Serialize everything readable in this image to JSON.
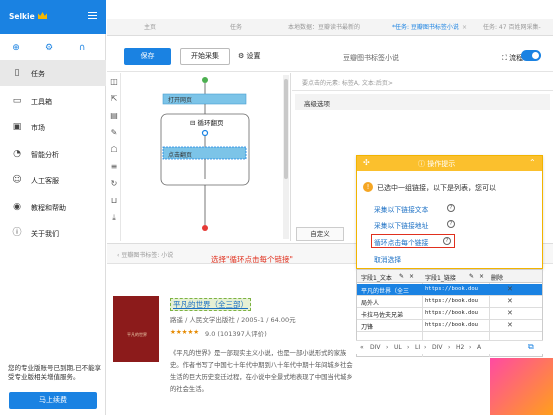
{
  "sidebar": {
    "logo": "Selkie",
    "items": [
      {
        "label": "任务",
        "icon": "file-icon",
        "active": true
      },
      {
        "label": "工具箱",
        "icon": "toolbox-icon",
        "active": false
      },
      {
        "label": "市场",
        "icon": "market-icon",
        "active": false
      },
      {
        "label": "智能分析",
        "icon": "analytics-icon",
        "active": false
      },
      {
        "label": "人工客服",
        "icon": "customer-service-icon",
        "active": false
      },
      {
        "label": "教程和帮助",
        "icon": "help-icon",
        "active": false
      },
      {
        "label": "关于我们",
        "icon": "info-icon",
        "active": false
      }
    ],
    "note": "您的专业版账号已到期,已不能享受专业版相关增值服务。",
    "renew_button": "马上续费"
  },
  "tabs": [
    {
      "label": "主页",
      "active": false
    },
    {
      "label": "任务",
      "active": false
    },
    {
      "label": "本地数据：豆瓣读书最新的",
      "active": false
    },
    {
      "label": "*任务: 豆瓣图书标签小说",
      "active": true
    },
    {
      "label": "任务: 47 百姓网采集-",
      "active": false
    }
  ],
  "toolbar": {
    "save": "保存",
    "start": "开始采集",
    "settings": "设置",
    "task_title": "豆瓣图书标签小说",
    "flow_label": "流程"
  },
  "flow": {
    "node_open": "打开网页",
    "loop_label": "循环翻页",
    "node_click": "点击翻页"
  },
  "config": {
    "selected_label": "要点击的元素: 标签A, 文本:后页>",
    "advanced": "高级选项",
    "custom": "自定义"
  },
  "preview": {
    "url": "豆瓣图书标签: 小说",
    "hint": "选择\"循环点击每个链接\"",
    "book": {
      "cover_text": "平凡的世界",
      "title": "平凡的世界（全三部）",
      "meta": "路遥 / 人民文学出版社 / 2005-1 / 64.00元",
      "stars": "★★★★★",
      "score": "9.0 (101397人评价)",
      "desc": "《平凡的世界》是一部现实主义小说，也是一部小说形式的家族史。作者书写了中国七十年代中期到八十年代中期十年间城乡社会生活的巨大历史变迁过程，在小说中全景式地表现了中国当代城乡的社会生活。"
    }
  },
  "tips": {
    "title": "操作提示",
    "info": "已选中一组链接，以下是列表，您可以",
    "options": [
      "采集以下链接文本",
      "采集以下链接地址",
      "循环点击每个链接",
      "取消选择"
    ]
  },
  "table": {
    "headers": [
      "字段1_文本",
      "字段1_链接",
      "删除"
    ],
    "rows": [
      {
        "text": "平凡的世界（全三",
        "link": "https://book.dou",
        "selected": true
      },
      {
        "text": "局外人",
        "link": "https://book.dou",
        "selected": false
      },
      {
        "text": "卡拉马佐夫兄弟",
        "link": "https://book.dou",
        "selected": false
      },
      {
        "text": "刀锋",
        "link": "https://book.dou",
        "selected": false
      }
    ]
  },
  "crumbs": [
    "«",
    "DIV",
    "›",
    "UL",
    "›",
    "LI",
    "›",
    "DIV",
    "›",
    "H2",
    "›",
    "A"
  ]
}
